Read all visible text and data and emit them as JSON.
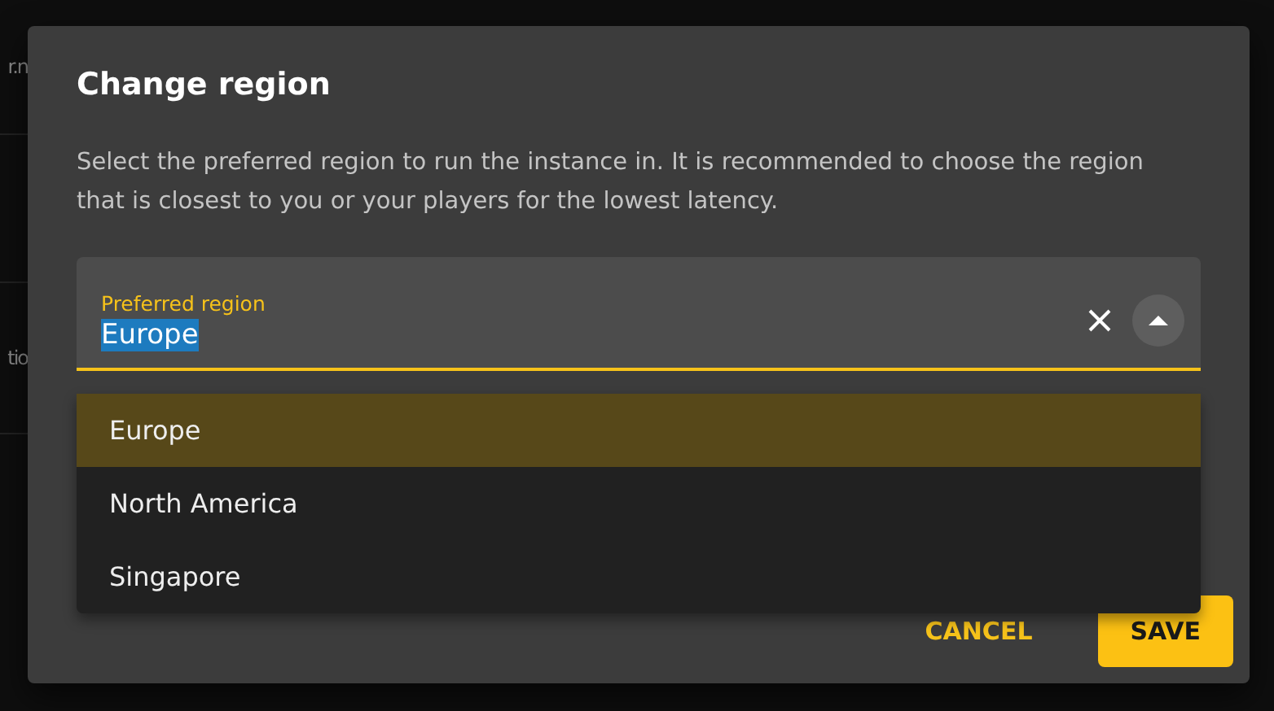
{
  "background_texts": [
    "r.n",
    "tio"
  ],
  "dialog": {
    "title": "Change region",
    "description": "Select the preferred region to run the instance in. It is recommended to choose the region that is closest to you or your players for the lowest latency.",
    "field": {
      "label": "Preferred region",
      "value": "Europe",
      "expanded": true
    },
    "options": [
      {
        "label": "Europe",
        "selected": true
      },
      {
        "label": "North America",
        "selected": false
      },
      {
        "label": "Singapore",
        "selected": false
      }
    ],
    "buttons": [
      {
        "label": "CANCEL",
        "kind": "text"
      },
      {
        "label": "SAVE",
        "kind": "primary"
      }
    ]
  }
}
